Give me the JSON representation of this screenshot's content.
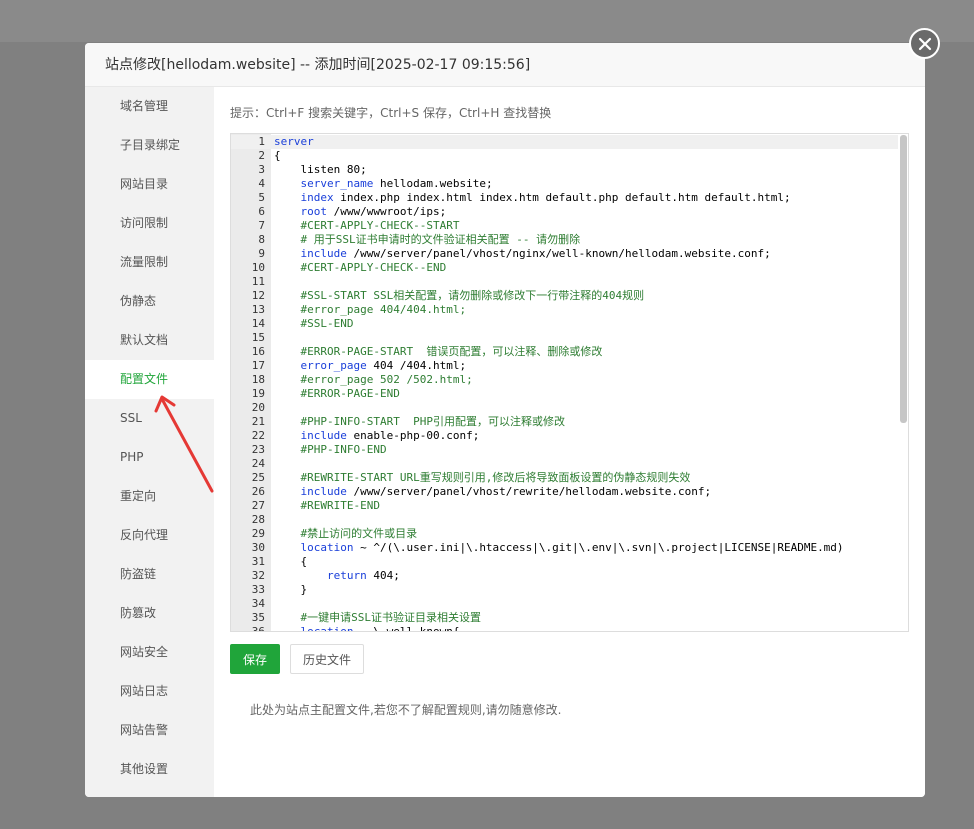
{
  "modal": {
    "title": "站点修改[hellodam.website] -- 添加时间[2025-02-17 09:15:56]"
  },
  "sidebar": {
    "items": [
      {
        "label": "域名管理",
        "active": false
      },
      {
        "label": "子目录绑定",
        "active": false
      },
      {
        "label": "网站目录",
        "active": false
      },
      {
        "label": "访问限制",
        "active": false
      },
      {
        "label": "流量限制",
        "active": false
      },
      {
        "label": "伪静态",
        "active": false
      },
      {
        "label": "默认文档",
        "active": false
      },
      {
        "label": "配置文件",
        "active": true
      },
      {
        "label": "SSL",
        "active": false
      },
      {
        "label": "PHP",
        "active": false
      },
      {
        "label": "重定向",
        "active": false
      },
      {
        "label": "反向代理",
        "active": false
      },
      {
        "label": "防盗链",
        "active": false
      },
      {
        "label": "防篡改",
        "active": false
      },
      {
        "label": "网站安全",
        "active": false
      },
      {
        "label": "网站日志",
        "active": false
      },
      {
        "label": "网站告警",
        "active": false
      },
      {
        "label": "其他设置",
        "active": false
      }
    ]
  },
  "hint": "提示：Ctrl+F 搜索关键字，Ctrl+S 保存，Ctrl+H 查找替换",
  "editor": {
    "lines": [
      {
        "n": "1",
        "t": "server"
      },
      {
        "n": "2",
        "t": "{"
      },
      {
        "n": "3",
        "t": "    listen 80;"
      },
      {
        "n": "4",
        "t": "    server_name hellodam.website;"
      },
      {
        "n": "5",
        "t": "    index index.php index.html index.htm default.php default.htm default.html;"
      },
      {
        "n": "6",
        "t": "    root /www/wwwroot/ips;"
      },
      {
        "n": "7",
        "t": "    #CERT-APPLY-CHECK--START"
      },
      {
        "n": "8",
        "t": "    # 用于SSL证书申请时的文件验证相关配置 -- 请勿删除"
      },
      {
        "n": "9",
        "t": "    include /www/server/panel/vhost/nginx/well-known/hellodam.website.conf;"
      },
      {
        "n": "10",
        "t": "    #CERT-APPLY-CHECK--END"
      },
      {
        "n": "11",
        "t": ""
      },
      {
        "n": "12",
        "t": "    #SSL-START SSL相关配置，请勿删除或修改下一行带注释的404规则"
      },
      {
        "n": "13",
        "t": "    #error_page 404/404.html;"
      },
      {
        "n": "14",
        "t": "    #SSL-END"
      },
      {
        "n": "15",
        "t": ""
      },
      {
        "n": "16",
        "t": "    #ERROR-PAGE-START  错误页配置，可以注释、删除或修改"
      },
      {
        "n": "17",
        "t": "    error_page 404 /404.html;"
      },
      {
        "n": "18",
        "t": "    #error_page 502 /502.html;"
      },
      {
        "n": "19",
        "t": "    #ERROR-PAGE-END"
      },
      {
        "n": "20",
        "t": ""
      },
      {
        "n": "21",
        "t": "    #PHP-INFO-START  PHP引用配置，可以注释或修改"
      },
      {
        "n": "22",
        "t": "    include enable-php-00.conf;"
      },
      {
        "n": "23",
        "t": "    #PHP-INFO-END"
      },
      {
        "n": "24",
        "t": ""
      },
      {
        "n": "25",
        "t": "    #REWRITE-START URL重写规则引用,修改后将导致面板设置的伪静态规则失效"
      },
      {
        "n": "26",
        "t": "    include /www/server/panel/vhost/rewrite/hellodam.website.conf;"
      },
      {
        "n": "27",
        "t": "    #REWRITE-END"
      },
      {
        "n": "28",
        "t": ""
      },
      {
        "n": "29",
        "t": "    #禁止访问的文件或目录"
      },
      {
        "n": "30",
        "t": "    location ~ ^/(\\.user.ini|\\.htaccess|\\.git|\\.env|\\.svn|\\.project|LICENSE|README.md)"
      },
      {
        "n": "31",
        "t": "    {"
      },
      {
        "n": "32",
        "t": "        return 404;"
      },
      {
        "n": "33",
        "t": "    }"
      },
      {
        "n": "34",
        "t": ""
      },
      {
        "n": "35",
        "t": "    #一键申请SSL证书验证目录相关设置"
      },
      {
        "n": "36",
        "t": "    location ~ \\.well-known{"
      }
    ]
  },
  "buttons": {
    "save": "保存",
    "history": "历史文件"
  },
  "note": "此处为站点主配置文件,若您不了解配置规则,请勿随意修改.",
  "colors": {
    "accent": "#20a53a",
    "arrow": "#e53935"
  }
}
